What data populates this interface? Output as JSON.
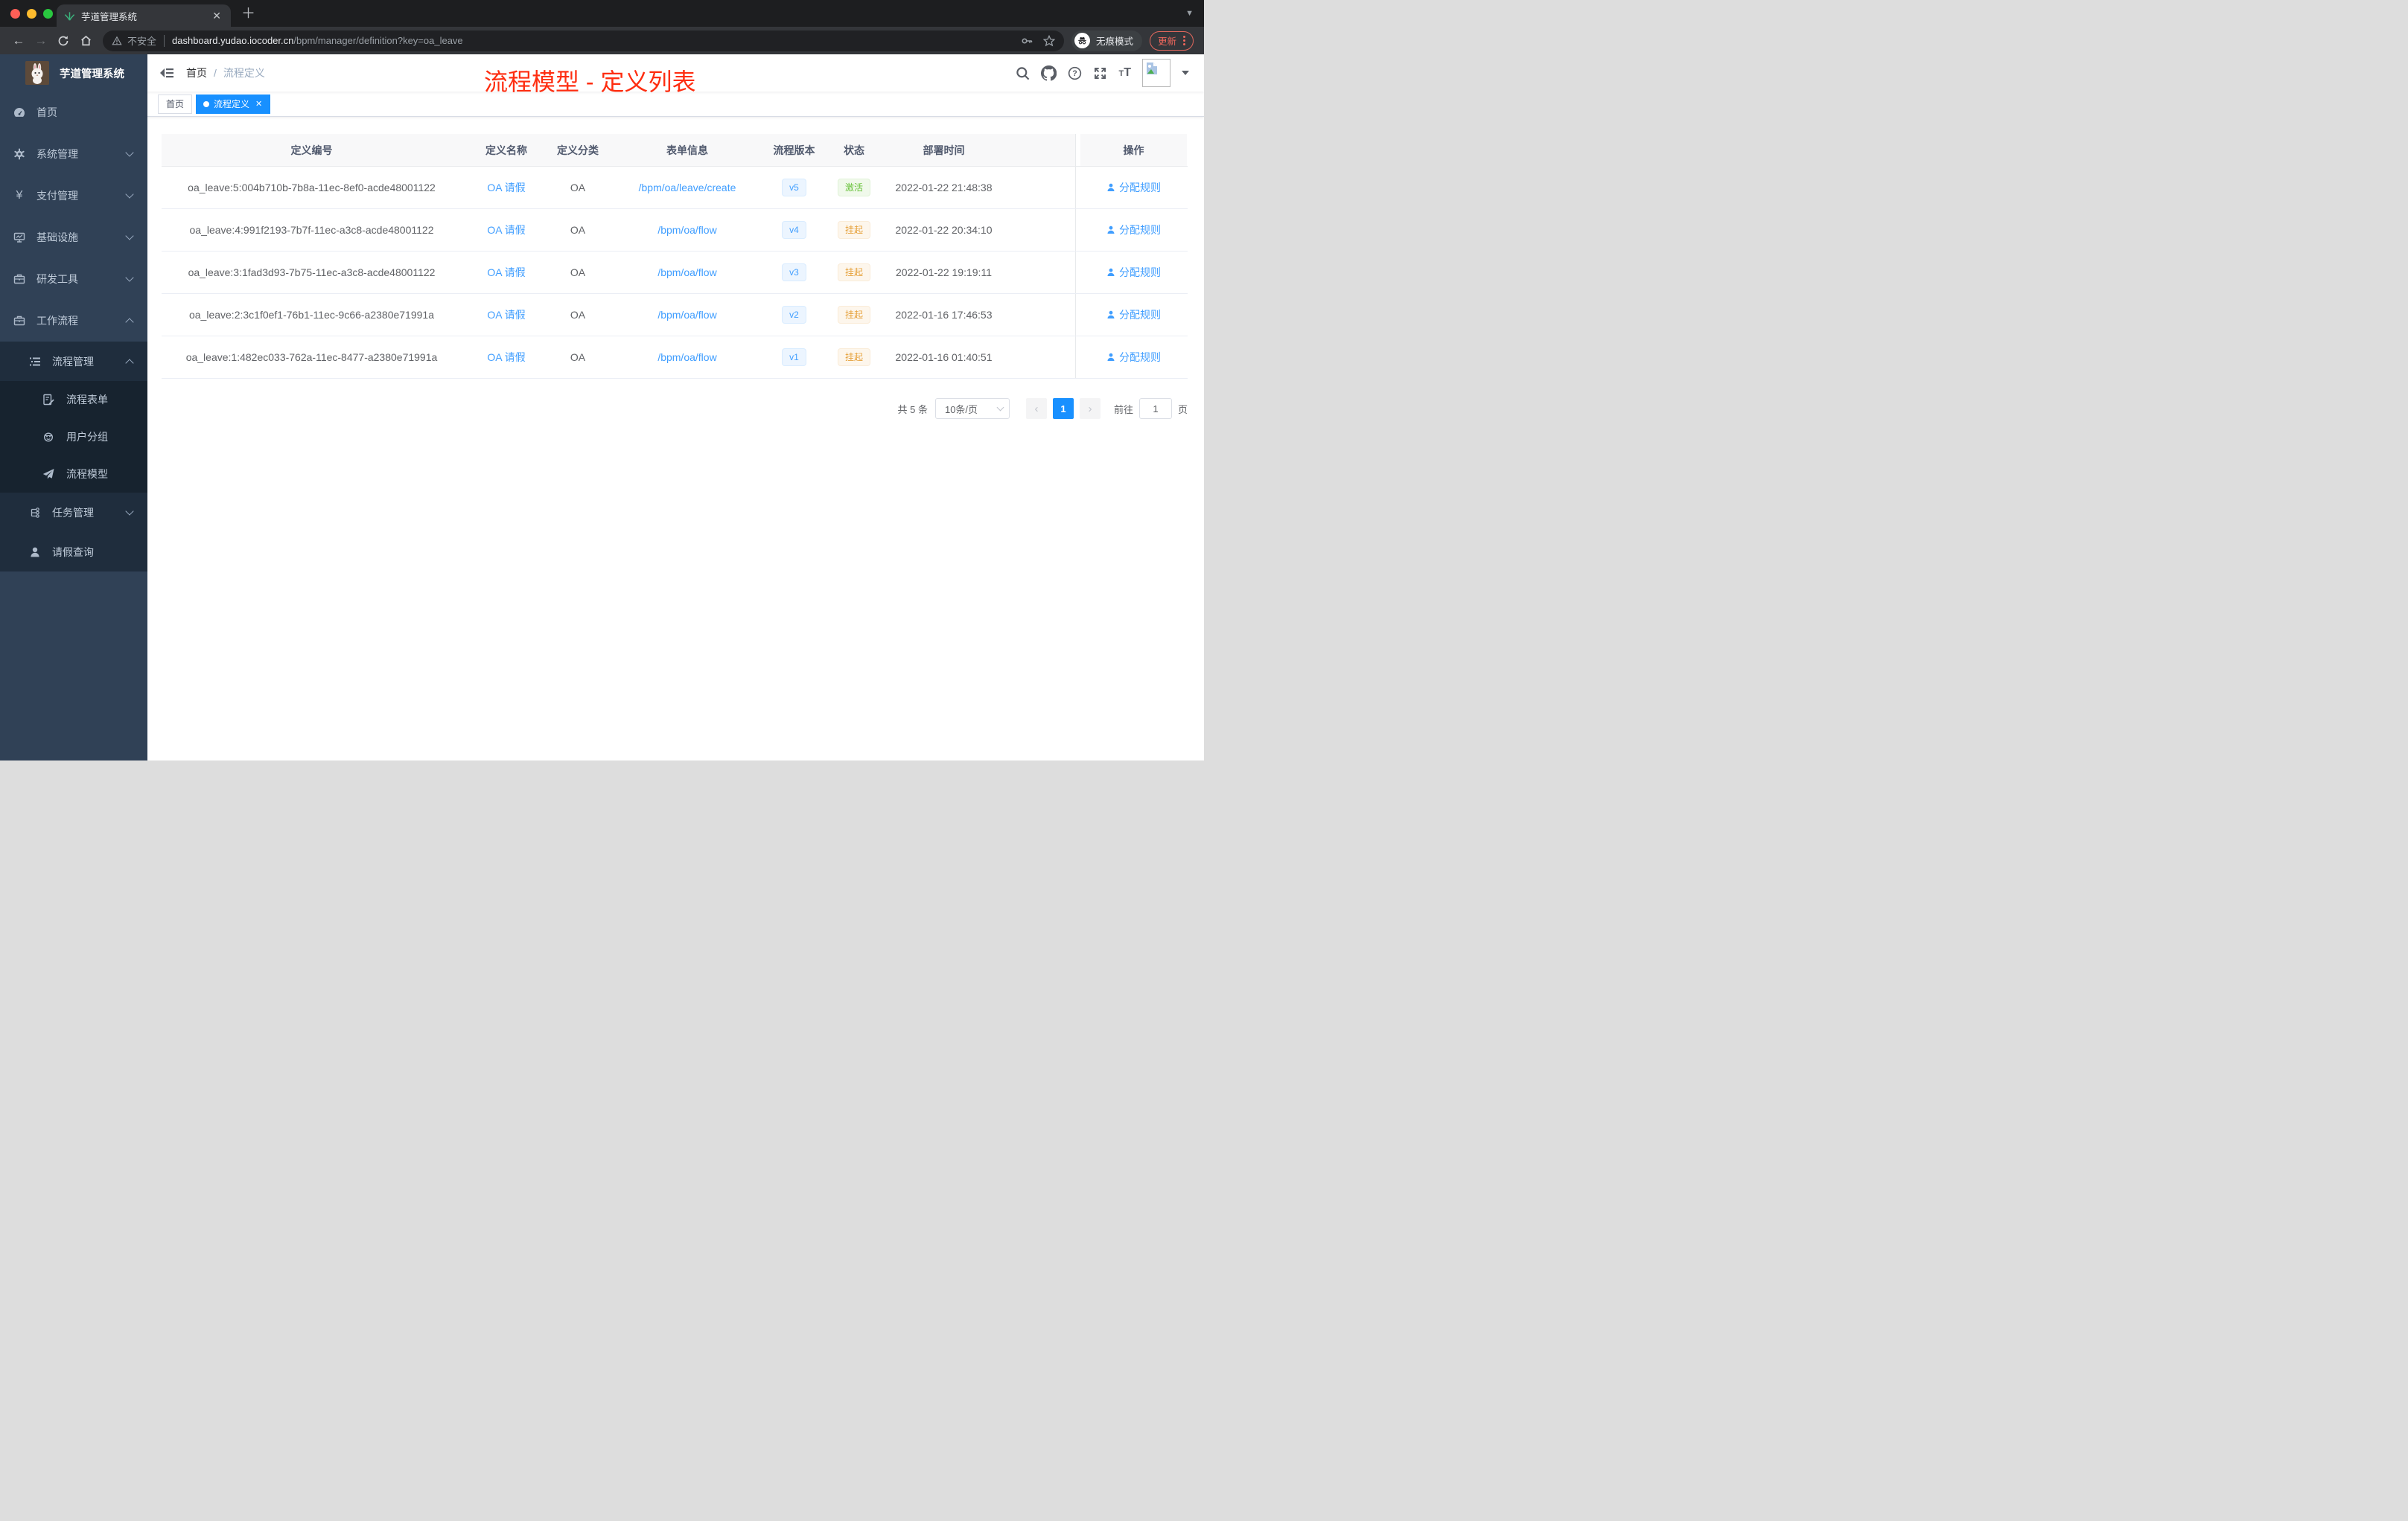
{
  "colors": {
    "accent_blue": "#1890ff",
    "link_blue": "#409eff",
    "success_green": "#67c23a",
    "warning_orange": "#e6a23c",
    "annotation_red": "#fe2d10",
    "sidebar_bg": "#304156"
  },
  "browser": {
    "tab_title": "芋道管理系统",
    "security_label": "不安全",
    "url_domain": "dashboard.yudao.iocoder.cn",
    "url_path": "/bpm/manager/definition?key=oa_leave",
    "incognito_label": "无痕模式",
    "update_label": "更新",
    "icons": [
      "back-icon",
      "forward-icon",
      "reload-icon",
      "home-icon",
      "warning-icon",
      "key-icon",
      "star-icon",
      "incognito-icon",
      "kebab-menu-icon",
      "tab-favicon-leaf",
      "new-tab-icon",
      "tab-search-icon"
    ]
  },
  "sidebar": {
    "logo_title": "芋道管理系统",
    "items": [
      {
        "label": "首页",
        "icon": "dashboard-icon"
      },
      {
        "label": "系统管理",
        "icon": "gear-icon",
        "chevron": "down"
      },
      {
        "label": "支付管理",
        "icon": "yen-icon",
        "chevron": "down"
      },
      {
        "label": "基础设施",
        "icon": "monitor-icon",
        "chevron": "down"
      },
      {
        "label": "研发工具",
        "icon": "toolbox-icon",
        "chevron": "down"
      },
      {
        "label": "工作流程",
        "icon": "briefcase-icon",
        "chevron": "up",
        "children": [
          {
            "label": "流程管理",
            "icon": "list-icon",
            "chevron": "up",
            "children": [
              {
                "label": "流程表单",
                "icon": "form-icon"
              },
              {
                "label": "用户分组",
                "icon": "robot-icon"
              },
              {
                "label": "流程模型",
                "icon": "send-icon"
              }
            ]
          },
          {
            "label": "任务管理",
            "icon": "tree-icon",
            "chevron": "down"
          },
          {
            "label": "请假查询",
            "icon": "user-icon"
          }
        ]
      }
    ]
  },
  "header": {
    "breadcrumb": [
      "首页",
      "流程定义"
    ],
    "icons": [
      "search-icon",
      "github-icon",
      "help-icon",
      "fullscreen-icon",
      "font-size-icon",
      "avatar",
      "caret-down-icon"
    ]
  },
  "annotation": {
    "text": "流程模型 - 定义列表"
  },
  "tags": [
    {
      "label": "首页"
    },
    {
      "label": "流程定义"
    }
  ],
  "table": {
    "columns": [
      "定义编号",
      "定义名称",
      "定义分类",
      "表单信息",
      "流程版本",
      "状态",
      "部署时间",
      "操作"
    ],
    "rows": [
      {
        "id": "oa_leave:5:004b710b-7b8a-11ec-8ef0-acde48001122",
        "name": "OA 请假",
        "category": "OA",
        "form": "/bpm/oa/leave/create",
        "version": "v5",
        "status": "激活",
        "status_type": "success",
        "time": "2022-01-22 21:48:38",
        "action": "分配规则"
      },
      {
        "id": "oa_leave:4:991f2193-7b7f-11ec-a3c8-acde48001122",
        "name": "OA 请假",
        "category": "OA",
        "form": "/bpm/oa/flow",
        "version": "v4",
        "status": "挂起",
        "status_type": "warning",
        "time": "2022-01-22 20:34:10",
        "action": "分配规则"
      },
      {
        "id": "oa_leave:3:1fad3d93-7b75-11ec-a3c8-acde48001122",
        "name": "OA 请假",
        "category": "OA",
        "form": "/bpm/oa/flow",
        "version": "v3",
        "status": "挂起",
        "status_type": "warning",
        "time": "2022-01-22 19:19:11",
        "action": "分配规则"
      },
      {
        "id": "oa_leave:2:3c1f0ef1-76b1-11ec-9c66-a2380e71991a",
        "name": "OA 请假",
        "category": "OA",
        "form": "/bpm/oa/flow",
        "version": "v2",
        "status": "挂起",
        "status_type": "warning",
        "time": "2022-01-16 17:46:53",
        "action": "分配规则"
      },
      {
        "id": "oa_leave:1:482ec033-762a-11ec-8477-a2380e71991a",
        "name": "OA 请假",
        "category": "OA",
        "form": "/bpm/oa/flow",
        "version": "v1",
        "status": "挂起",
        "status_type": "warning",
        "time": "2022-01-16 01:40:51",
        "action": "分配规则"
      }
    ]
  },
  "pagination": {
    "total_label": "共 5 条",
    "page_size_label": "10条/页",
    "prev_icon": "‹",
    "current_page": "1",
    "next_icon": "›",
    "goto_label": "前往",
    "goto_value": "1",
    "page_unit": "页"
  }
}
